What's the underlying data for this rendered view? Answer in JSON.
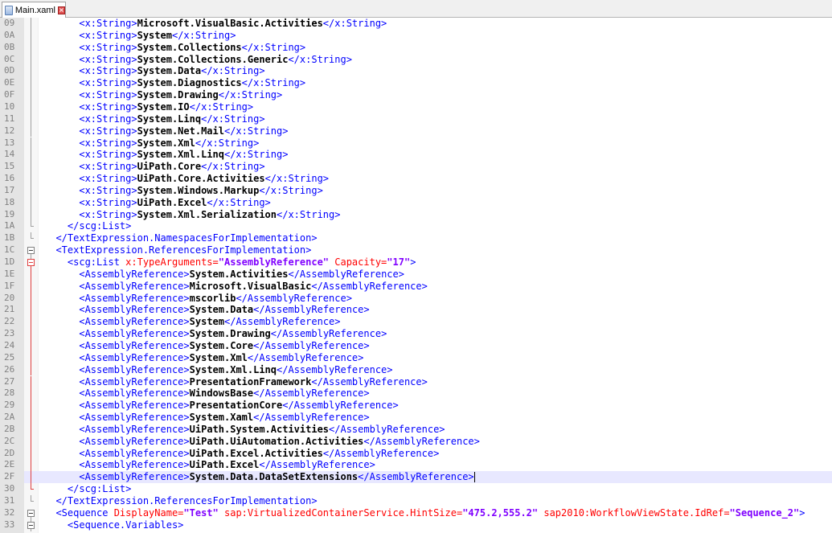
{
  "tab": {
    "title": "Main.xaml",
    "icon": "document-icon",
    "close_icon": "close-icon"
  },
  "editor": {
    "lines": [
      {
        "ln": "09",
        "indent": "      ",
        "parts": [
          [
            "t",
            "<x:String>"
          ],
          [
            "b",
            "Microsoft.VisualBasic.Activities"
          ],
          [
            "t",
            "</x:String>"
          ]
        ]
      },
      {
        "ln": "0A",
        "indent": "      ",
        "parts": [
          [
            "t",
            "<x:String>"
          ],
          [
            "b",
            "System"
          ],
          [
            "t",
            "</x:String>"
          ]
        ]
      },
      {
        "ln": "0B",
        "indent": "      ",
        "parts": [
          [
            "t",
            "<x:String>"
          ],
          [
            "b",
            "System.Collections"
          ],
          [
            "t",
            "</x:String>"
          ]
        ]
      },
      {
        "ln": "0C",
        "indent": "      ",
        "parts": [
          [
            "t",
            "<x:String>"
          ],
          [
            "b",
            "System.Collections.Generic"
          ],
          [
            "t",
            "</x:String>"
          ]
        ]
      },
      {
        "ln": "0D",
        "indent": "      ",
        "parts": [
          [
            "t",
            "<x:String>"
          ],
          [
            "b",
            "System.Data"
          ],
          [
            "t",
            "</x:String>"
          ]
        ]
      },
      {
        "ln": "0E",
        "indent": "      ",
        "parts": [
          [
            "t",
            "<x:String>"
          ],
          [
            "b",
            "System.Diagnostics"
          ],
          [
            "t",
            "</x:String>"
          ]
        ]
      },
      {
        "ln": "0F",
        "indent": "      ",
        "parts": [
          [
            "t",
            "<x:String>"
          ],
          [
            "b",
            "System.Drawing"
          ],
          [
            "t",
            "</x:String>"
          ]
        ]
      },
      {
        "ln": "10",
        "indent": "      ",
        "parts": [
          [
            "t",
            "<x:String>"
          ],
          [
            "b",
            "System.IO"
          ],
          [
            "t",
            "</x:String>"
          ]
        ]
      },
      {
        "ln": "11",
        "indent": "      ",
        "parts": [
          [
            "t",
            "<x:String>"
          ],
          [
            "b",
            "System.Linq"
          ],
          [
            "t",
            "</x:String>"
          ]
        ]
      },
      {
        "ln": "12",
        "indent": "      ",
        "parts": [
          [
            "t",
            "<x:String>"
          ],
          [
            "b",
            "System.Net.Mail"
          ],
          [
            "t",
            "</x:String>"
          ]
        ]
      },
      {
        "ln": "13",
        "indent": "      ",
        "parts": [
          [
            "t",
            "<x:String>"
          ],
          [
            "b",
            "System.Xml"
          ],
          [
            "t",
            "</x:String>"
          ]
        ]
      },
      {
        "ln": "14",
        "indent": "      ",
        "parts": [
          [
            "t",
            "<x:String>"
          ],
          [
            "b",
            "System.Xml.Linq"
          ],
          [
            "t",
            "</x:String>"
          ]
        ]
      },
      {
        "ln": "15",
        "indent": "      ",
        "parts": [
          [
            "t",
            "<x:String>"
          ],
          [
            "b",
            "UiPath.Core"
          ],
          [
            "t",
            "</x:String>"
          ]
        ]
      },
      {
        "ln": "16",
        "indent": "      ",
        "parts": [
          [
            "t",
            "<x:String>"
          ],
          [
            "b",
            "UiPath.Core.Activities"
          ],
          [
            "t",
            "</x:String>"
          ]
        ]
      },
      {
        "ln": "17",
        "indent": "      ",
        "parts": [
          [
            "t",
            "<x:String>"
          ],
          [
            "b",
            "System.Windows.Markup"
          ],
          [
            "t",
            "</x:String>"
          ]
        ]
      },
      {
        "ln": "18",
        "indent": "      ",
        "parts": [
          [
            "t",
            "<x:String>"
          ],
          [
            "b",
            "UiPath.Excel"
          ],
          [
            "t",
            "</x:String>"
          ]
        ]
      },
      {
        "ln": "19",
        "indent": "      ",
        "parts": [
          [
            "t",
            "<x:String>"
          ],
          [
            "b",
            "System.Xml.Serialization"
          ],
          [
            "t",
            "</x:String>"
          ]
        ]
      },
      {
        "ln": "1A",
        "indent": "    ",
        "parts": [
          [
            "t",
            "</scg:List>"
          ]
        ]
      },
      {
        "ln": "1B",
        "indent": "  ",
        "parts": [
          [
            "t",
            "</TextExpression.NamespacesForImplementation>"
          ]
        ]
      },
      {
        "ln": "1C",
        "indent": "  ",
        "parts": [
          [
            "t",
            "<TextExpression.ReferencesForImplementation>"
          ]
        ]
      },
      {
        "ln": "1D",
        "indent": "    ",
        "parts": [
          [
            "t",
            "<scg:List "
          ],
          [
            "a",
            "x:TypeArguments="
          ],
          [
            "v",
            "\"AssemblyReference\""
          ],
          [
            "a",
            " Capacity="
          ],
          [
            "v",
            "\"17\""
          ],
          [
            "t",
            ">"
          ]
        ]
      },
      {
        "ln": "1E",
        "indent": "      ",
        "parts": [
          [
            "t",
            "<AssemblyReference>"
          ],
          [
            "b",
            "System.Activities"
          ],
          [
            "t",
            "</AssemblyReference>"
          ]
        ]
      },
      {
        "ln": "1F",
        "indent": "      ",
        "parts": [
          [
            "t",
            "<AssemblyReference>"
          ],
          [
            "b",
            "Microsoft.VisualBasic"
          ],
          [
            "t",
            "</AssemblyReference>"
          ]
        ]
      },
      {
        "ln": "20",
        "indent": "      ",
        "parts": [
          [
            "t",
            "<AssemblyReference>"
          ],
          [
            "b",
            "mscorlib"
          ],
          [
            "t",
            "</AssemblyReference>"
          ]
        ]
      },
      {
        "ln": "21",
        "indent": "      ",
        "parts": [
          [
            "t",
            "<AssemblyReference>"
          ],
          [
            "b",
            "System.Data"
          ],
          [
            "t",
            "</AssemblyReference>"
          ]
        ]
      },
      {
        "ln": "22",
        "indent": "      ",
        "parts": [
          [
            "t",
            "<AssemblyReference>"
          ],
          [
            "b",
            "System"
          ],
          [
            "t",
            "</AssemblyReference>"
          ]
        ]
      },
      {
        "ln": "23",
        "indent": "      ",
        "parts": [
          [
            "t",
            "<AssemblyReference>"
          ],
          [
            "b",
            "System.Drawing"
          ],
          [
            "t",
            "</AssemblyReference>"
          ]
        ]
      },
      {
        "ln": "24",
        "indent": "      ",
        "parts": [
          [
            "t",
            "<AssemblyReference>"
          ],
          [
            "b",
            "System.Core"
          ],
          [
            "t",
            "</AssemblyReference>"
          ]
        ]
      },
      {
        "ln": "25",
        "indent": "      ",
        "parts": [
          [
            "t",
            "<AssemblyReference>"
          ],
          [
            "b",
            "System.Xml"
          ],
          [
            "t",
            "</AssemblyReference>"
          ]
        ]
      },
      {
        "ln": "26",
        "indent": "      ",
        "parts": [
          [
            "t",
            "<AssemblyReference>"
          ],
          [
            "b",
            "System.Xml.Linq"
          ],
          [
            "t",
            "</AssemblyReference>"
          ]
        ]
      },
      {
        "ln": "27",
        "indent": "      ",
        "parts": [
          [
            "t",
            "<AssemblyReference>"
          ],
          [
            "b",
            "PresentationFramework"
          ],
          [
            "t",
            "</AssemblyReference>"
          ]
        ]
      },
      {
        "ln": "28",
        "indent": "      ",
        "parts": [
          [
            "t",
            "<AssemblyReference>"
          ],
          [
            "b",
            "WindowsBase"
          ],
          [
            "t",
            "</AssemblyReference>"
          ]
        ]
      },
      {
        "ln": "29",
        "indent": "      ",
        "parts": [
          [
            "t",
            "<AssemblyReference>"
          ],
          [
            "b",
            "PresentationCore"
          ],
          [
            "t",
            "</AssemblyReference>"
          ]
        ]
      },
      {
        "ln": "2A",
        "indent": "      ",
        "parts": [
          [
            "t",
            "<AssemblyReference>"
          ],
          [
            "b",
            "System.Xaml"
          ],
          [
            "t",
            "</AssemblyReference>"
          ]
        ]
      },
      {
        "ln": "2B",
        "indent": "      ",
        "parts": [
          [
            "t",
            "<AssemblyReference>"
          ],
          [
            "b",
            "UiPath.System.Activities"
          ],
          [
            "t",
            "</AssemblyReference>"
          ]
        ]
      },
      {
        "ln": "2C",
        "indent": "      ",
        "parts": [
          [
            "t",
            "<AssemblyReference>"
          ],
          [
            "b",
            "UiPath.UiAutomation.Activities"
          ],
          [
            "t",
            "</AssemblyReference>"
          ]
        ]
      },
      {
        "ln": "2D",
        "indent": "      ",
        "parts": [
          [
            "t",
            "<AssemblyReference>"
          ],
          [
            "b",
            "UiPath.Excel.Activities"
          ],
          [
            "t",
            "</AssemblyReference>"
          ]
        ]
      },
      {
        "ln": "2E",
        "indent": "      ",
        "parts": [
          [
            "t",
            "<AssemblyReference>"
          ],
          [
            "b",
            "UiPath.Excel"
          ],
          [
            "t",
            "</AssemblyReference>"
          ]
        ]
      },
      {
        "ln": "2F",
        "indent": "      ",
        "parts": [
          [
            "t",
            "<AssemblyReference>"
          ],
          [
            "b",
            "System.Data.DataSetExtensions"
          ],
          [
            "t",
            "</AssemblyReference>"
          ]
        ],
        "current": true
      },
      {
        "ln": "30",
        "indent": "    ",
        "parts": [
          [
            "t",
            "</scg:List>"
          ]
        ]
      },
      {
        "ln": "31",
        "indent": "  ",
        "parts": [
          [
            "t",
            "</TextExpression.ReferencesForImplementation>"
          ]
        ]
      },
      {
        "ln": "32",
        "indent": "  ",
        "parts": [
          [
            "t",
            "<Sequence "
          ],
          [
            "a",
            "DisplayName="
          ],
          [
            "v",
            "\"Test\""
          ],
          [
            "a",
            " sap:VirtualizedContainerService.HintSize="
          ],
          [
            "v",
            "\"475.2,555.2\""
          ],
          [
            "a",
            " sap2010:WorkflowViewState.IdRef="
          ],
          [
            "v",
            "\"Sequence_2\""
          ],
          [
            "t",
            ">"
          ]
        ]
      },
      {
        "ln": "33",
        "indent": "    ",
        "parts": [
          [
            "t",
            "<Sequence.Variables>"
          ]
        ]
      }
    ],
    "fold_markers": {
      "1B": "end",
      "1C": "open",
      "1D": "open-red",
      "32": "open",
      "33": "open"
    }
  }
}
